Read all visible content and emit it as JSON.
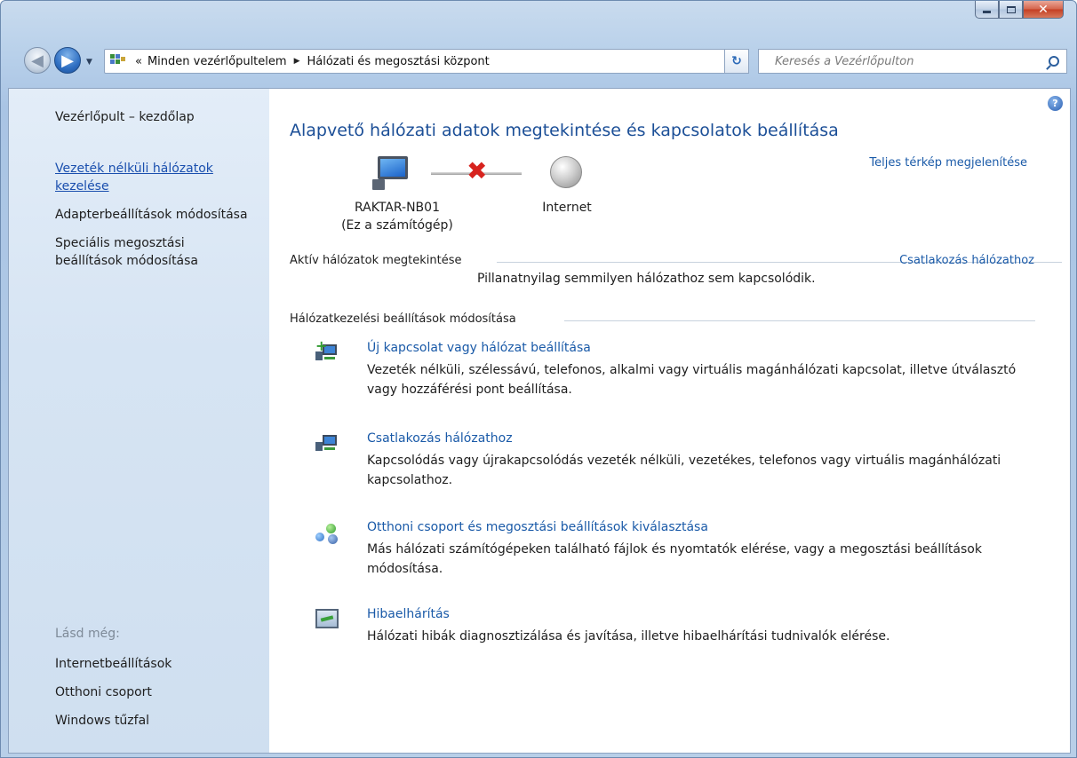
{
  "window": {
    "minimize_glyph": "minimize-icon",
    "maximize_glyph": "maximize-icon",
    "close_glyph": "✕"
  },
  "nav": {
    "back_glyph": "◀",
    "forward_glyph": "▶",
    "address_overflow": "«",
    "breadcrumb": [
      "Minden vezérlőpultelem",
      "Hálózati és megosztási központ"
    ],
    "search_placeholder": "Keresés a Vezérlőpulton",
    "refresh_glyph": "↻"
  },
  "sidebar": {
    "home": "Vezérlőpult – kezdőlap",
    "links": [
      {
        "label": "Vezeték nélküli hálózatok kezelése",
        "line1": "Vezeték nélküli hálózatok",
        "line2": "kezelése"
      },
      {
        "label": "Adapterbeállítások módosítása"
      },
      {
        "label": "Speciális megosztási beállítások módosítása",
        "line1": "Speciális megosztási",
        "line2": "beállítások módosítása"
      }
    ],
    "see_also_title": "Lásd még:",
    "see_also": [
      "Internetbeállítások",
      "Otthoni csoport",
      "Windows tűzfal"
    ]
  },
  "main": {
    "help_glyph": "?",
    "title": "Alapvető hálózati adatok megtekintése és kapcsolatok beállítása",
    "full_map_link": "Teljes térkép megjelenítése",
    "map": {
      "computer_name": "RAKTAR-NB01",
      "computer_sub": "(Ez a számítógép)",
      "internet_label": "Internet",
      "status": "disconnected"
    },
    "active_networks": {
      "heading": "Aktív hálózatok megtekintése",
      "connect_link": "Csatlakozás hálózathoz",
      "message": "Pillanatnyilag semmilyen hálózathoz sem kapcsolódik."
    },
    "settings_heading": "Hálózatkezelési beállítások módosítása",
    "tasks": [
      {
        "icon": "new-connection-icon",
        "title": "Új kapcsolat vagy hálózat beállítása",
        "desc": "Vezeték nélküli, szélessávú, telefonos, alkalmi vagy virtuális magánhálózati kapcsolat, illetve útválasztó vagy hozzáférési pont beállítása."
      },
      {
        "icon": "connect-network-icon",
        "title": "Csatlakozás hálózathoz",
        "desc": "Kapcsolódás vagy újrakapcsolódás vezeték nélküli, vezetékes, telefonos vagy virtuális magánhálózati kapcsolathoz."
      },
      {
        "icon": "homegroup-icon",
        "title": "Otthoni csoport és megosztási beállítások kiválasztása",
        "desc": "Más hálózati számítógépeken található fájlok és nyomtatók elérése, vagy a megosztási beállítások módosítása."
      },
      {
        "icon": "troubleshoot-icon",
        "title": "Hibaelhárítás",
        "desc": "Hálózati hibák diagnosztizálása és javítása, illetve hibaelhárítási tudnivalók elérése."
      }
    ]
  }
}
